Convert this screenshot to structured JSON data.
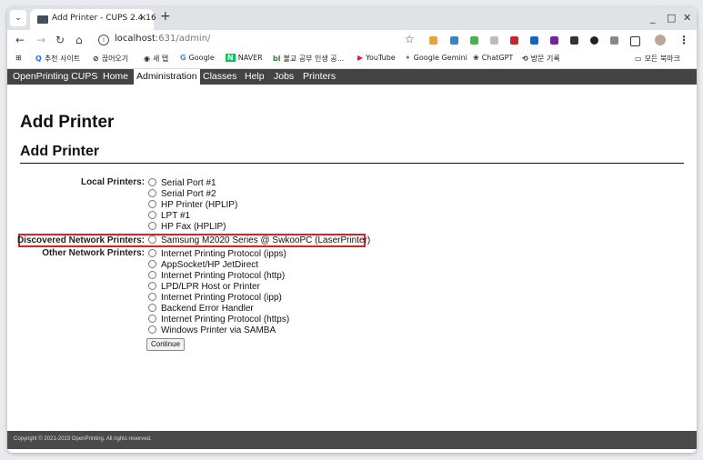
{
  "browser": {
    "tab_title": "Add Printer - CUPS 2.4.16",
    "tab_close": "×",
    "new_tab": "+",
    "tab_menu": "⌄",
    "window_controls": {
      "minimize": "_",
      "maximize": "□",
      "close": "✕"
    },
    "url_host": "localhost",
    "url_path": ":631/admin/",
    "bookmarks": [
      {
        "icon": "magnifier-icon",
        "glyph": "Q",
        "label": "추천 사이트"
      },
      {
        "icon": "blocked-circle-icon",
        "glyph": "⊘",
        "label": "끊어오기"
      },
      {
        "icon": "web-icon",
        "glyph": "◉",
        "label": "새 탭"
      },
      {
        "icon": "google-icon",
        "glyph": "G",
        "label": "Google"
      },
      {
        "icon": "naver-icon",
        "glyph": "N",
        "label": "NAVER"
      },
      {
        "icon": "bi-icon",
        "glyph": "bl",
        "label": "불교 공부 인생 공..."
      },
      {
        "icon": "youtube-icon",
        "glyph": "▶",
        "label": "YouTube"
      },
      {
        "icon": "gemini-icon",
        "glyph": "✦",
        "label": "Google Gemini"
      },
      {
        "icon": "chatgpt-icon",
        "glyph": "❀",
        "label": "ChatGPT"
      },
      {
        "icon": "history-icon",
        "glyph": "⟲",
        "label": "방문 기록"
      }
    ],
    "all_bookmarks_label": "모든 북마크",
    "colors": {
      "tabstrip": "#dfe3e8",
      "accent_red": "#e02020"
    }
  },
  "cups": {
    "nav": [
      "OpenPrinting CUPS",
      "Home",
      "Administration",
      "Classes",
      "Help",
      "Jobs",
      "Printers"
    ],
    "active_nav": "Administration",
    "page_title": "Add Printer",
    "section_title": "Add Printer",
    "local_label": "Local Printers:",
    "local_options": [
      "Serial Port #1",
      "Serial Port #2",
      "HP Printer (HPLIP)",
      "LPT #1",
      "HP Fax (HPLIP)"
    ],
    "discovered_label": "Discovered Network Printers:",
    "discovered_options": [
      "Samsung M2020 Series @ SwkooPC (LaserPrinter)"
    ],
    "other_label": "Other Network Printers:",
    "other_options": [
      "Internet Printing Protocol (ipps)",
      "AppSocket/HP JetDirect",
      "Internet Printing Protocol (http)",
      "LPD/LPR Host or Printer",
      "Internet Printing Protocol (ipp)",
      "Backend Error Handler",
      "Internet Printing Protocol (https)",
      "Windows Printer via SAMBA"
    ],
    "continue_label": "Continue",
    "footer": "Copyright © 2021-2023 OpenPrinting. All rights reserved."
  }
}
